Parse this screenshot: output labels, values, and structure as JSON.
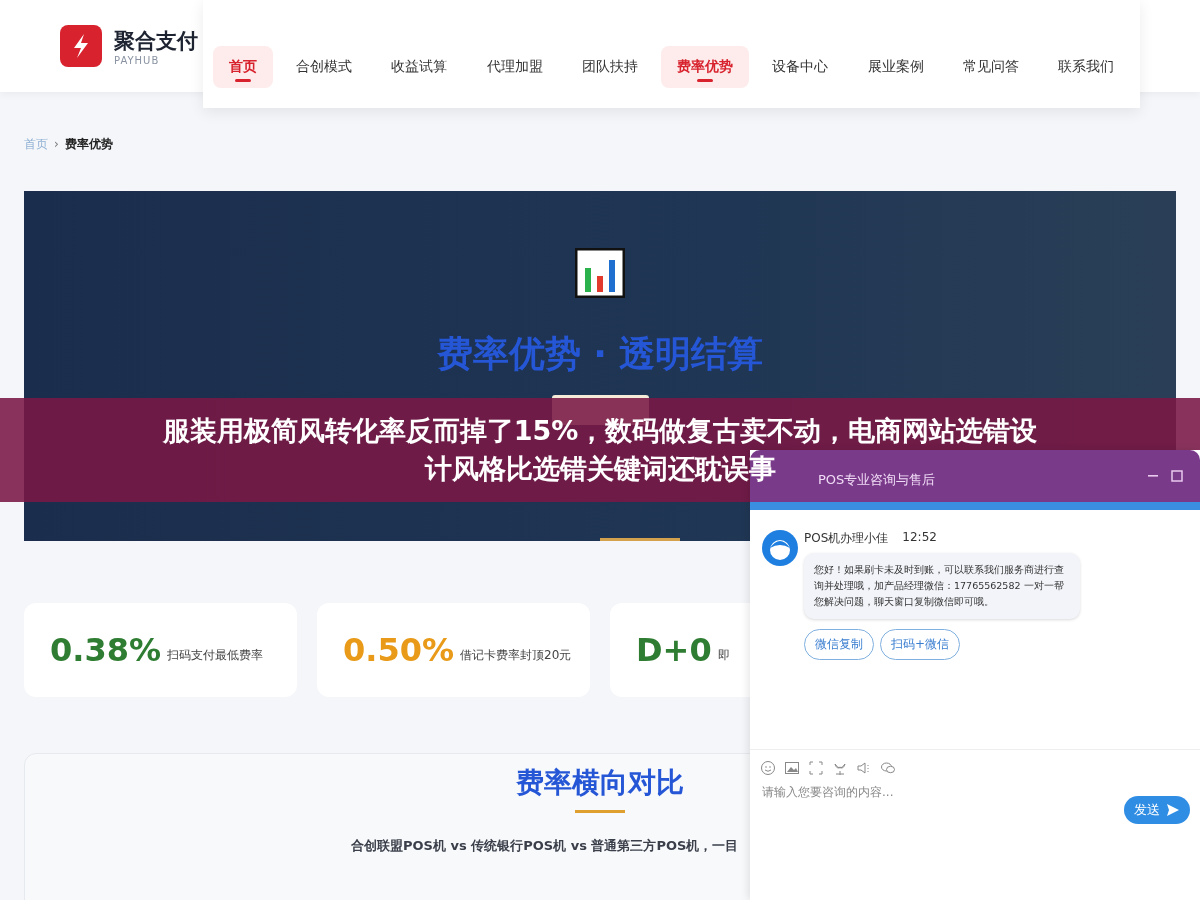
{
  "logo": {
    "name": "聚合支付",
    "tagline": "PAYHUB"
  },
  "nav": [
    {
      "label": "首页",
      "selected": true
    },
    {
      "label": "合创模式",
      "selected": false
    },
    {
      "label": "收益试算",
      "selected": false
    },
    {
      "label": "代理加盟",
      "selected": false
    },
    {
      "label": "团队扶持",
      "selected": false
    },
    {
      "label": "费率优势",
      "selected": true
    },
    {
      "label": "设备中心",
      "selected": false
    },
    {
      "label": "展业案例",
      "selected": false
    },
    {
      "label": "常见问答",
      "selected": false
    },
    {
      "label": "联系我们",
      "selected": false
    }
  ],
  "breadcrumb": {
    "items": [
      "首页",
      "费率优势"
    ],
    "separator": "›"
  },
  "hero": {
    "title": "费率优势 · 透明结算"
  },
  "stats": [
    {
      "value": "0.38%",
      "label": "扫码支付最低费率",
      "color": "#2e7d32"
    },
    {
      "value": "0.50%",
      "label": "借记卡费率封顶20元",
      "color": "#e89a18"
    },
    {
      "value": "D+0",
      "label": "即",
      "color": "#2e7d32"
    }
  ],
  "comparison": {
    "title": "费率横向对比",
    "subtitle": "合创联盟POS机 vs 传统银行POS机 vs 普通第三方POS机，一目"
  },
  "banner": [
    "服装用极简风转化率反而掉了15%，数码做复古卖不动，电商网站选错设",
    "计风格比选错关键词还耽误事"
  ],
  "chat": {
    "title": "POS专业咨询与售后",
    "sender": "POS机办理小佳",
    "time": "12:52",
    "message": "您好！如果刷卡未及时到账，可以联系我们服务商进行查询并处理哦，加产品经理微信：17765562582 一对一帮您解决问题，聊天窗口复制微信即可哦。",
    "actions": [
      "微信复制",
      "扫码+微信"
    ],
    "placeholder": "请输入您要咨询的内容...",
    "send": "发送"
  }
}
